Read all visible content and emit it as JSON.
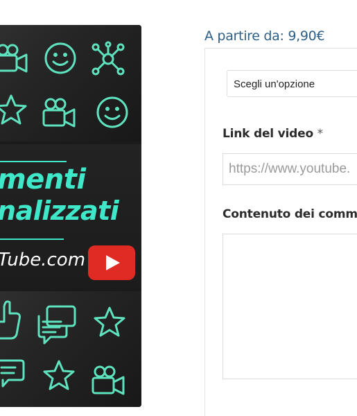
{
  "product_image": {
    "headline_line1": "menti",
    "headline_line2": "nalizzati",
    "domain": "Tube.com"
  },
  "price": {
    "label": "A partire da: 9,90€"
  },
  "form": {
    "select_value": "Scegli un'opzione",
    "video_link_label": "Link del video",
    "required_marker": "*",
    "video_link_placeholder": "https://www.youtube.",
    "comments_label": "Contenuto dei comme"
  },
  "colors": {
    "accent_green": "#3ee8c8",
    "price_blue": "#2d5f86",
    "youtube_red": "#e02a24"
  }
}
